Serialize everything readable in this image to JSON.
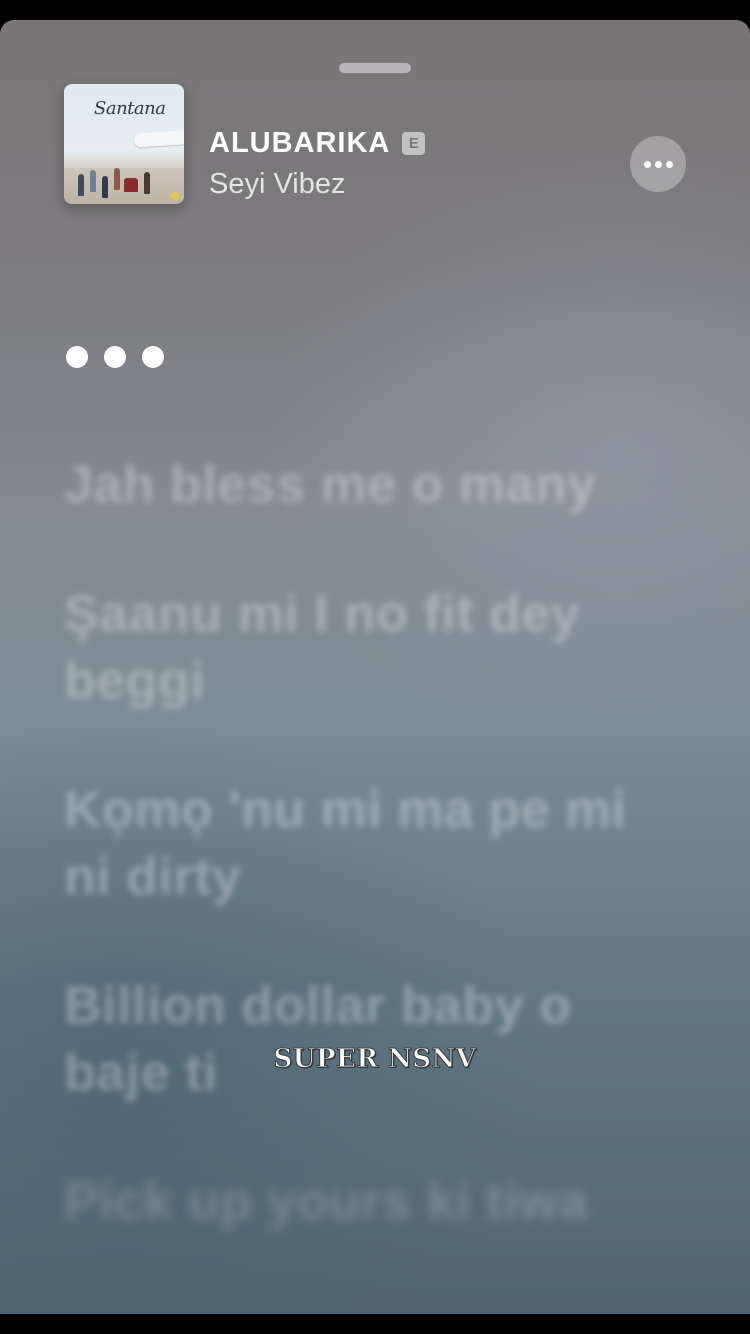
{
  "now_playing": {
    "title": "ALUBARIKA",
    "explicit_badge": "E",
    "artist": "Seyi Vibez",
    "album_art_text": "Santana"
  },
  "icons": {
    "more": "ellipsis-icon",
    "interlude": "interlude-dots-icon",
    "grabber": "sheet-grabber-icon"
  },
  "lyrics": [
    "Jah bless me o many",
    "Şaanu mi I no fit dey beggi",
    "Kọmọ 'nu mi ma pe mi ni dirty",
    "Billion dollar baby o baje ti",
    "Pick up yours ki tiwa"
  ],
  "watermark": "SUPER NSNV",
  "colors": {
    "background_top": "#7a7678",
    "background_bottom": "#4f6672",
    "text_primary": "#ffffff"
  }
}
